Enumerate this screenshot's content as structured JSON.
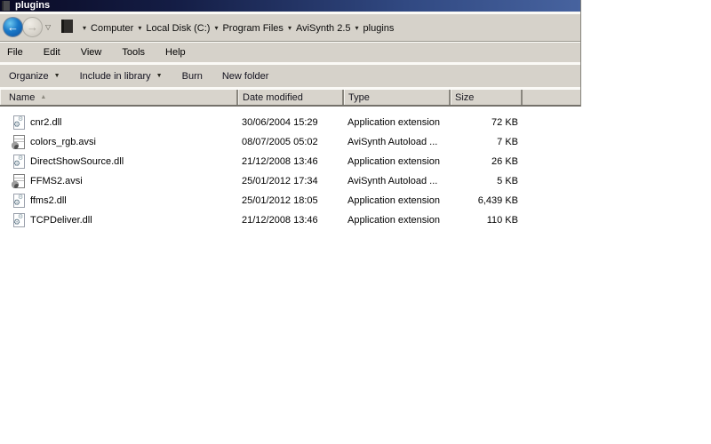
{
  "window": {
    "title": "plugins"
  },
  "navbar": {
    "back_icon": "left-arrow",
    "forward_icon": "right-arrow",
    "breadcrumb": [
      "Computer",
      "Local Disk (C:)",
      "Program Files",
      "AviSynth 2.5",
      "plugins"
    ]
  },
  "menu": {
    "items": [
      "File",
      "Edit",
      "View",
      "Tools",
      "Help"
    ]
  },
  "toolbar": {
    "items": [
      {
        "label": "Organize",
        "dropdown": true
      },
      {
        "label": "Include in library",
        "dropdown": true
      },
      {
        "label": "Burn",
        "dropdown": false
      },
      {
        "label": "New folder",
        "dropdown": false
      }
    ]
  },
  "columns": [
    {
      "label": "Name",
      "sorted": true
    },
    {
      "label": "Date modified",
      "sorted": false
    },
    {
      "label": "Type",
      "sorted": false
    },
    {
      "label": "Size",
      "sorted": false
    }
  ],
  "files": [
    {
      "name": "cnr2.dll",
      "date": "30/06/2004 15:29",
      "type": "Application extension",
      "size": "72 KB",
      "icon": "dll"
    },
    {
      "name": "colors_rgb.avsi",
      "date": "08/07/2005 05:02",
      "type": "AviSynth Autoload ...",
      "size": "7 KB",
      "icon": "avsi"
    },
    {
      "name": "DirectShowSource.dll",
      "date": "21/12/2008 13:46",
      "type": "Application extension",
      "size": "26 KB",
      "icon": "dll"
    },
    {
      "name": "FFMS2.avsi",
      "date": "25/01/2012 17:34",
      "type": "AviSynth Autoload ...",
      "size": "5 KB",
      "icon": "avsi"
    },
    {
      "name": "ffms2.dll",
      "date": "25/01/2012 18:05",
      "type": "Application extension",
      "size": "6,439 KB",
      "icon": "dll"
    },
    {
      "name": "TCPDeliver.dll",
      "date": "21/12/2008 13:46",
      "type": "Application extension",
      "size": "110 KB",
      "icon": "dll"
    }
  ],
  "colors": {
    "titlebar_dark": "#0a0a24",
    "titlebar_light": "#47639f",
    "chrome_bg": "#d6d2ca",
    "back_button_blue": "#1a79c8",
    "list_bg": "#ffffff"
  }
}
